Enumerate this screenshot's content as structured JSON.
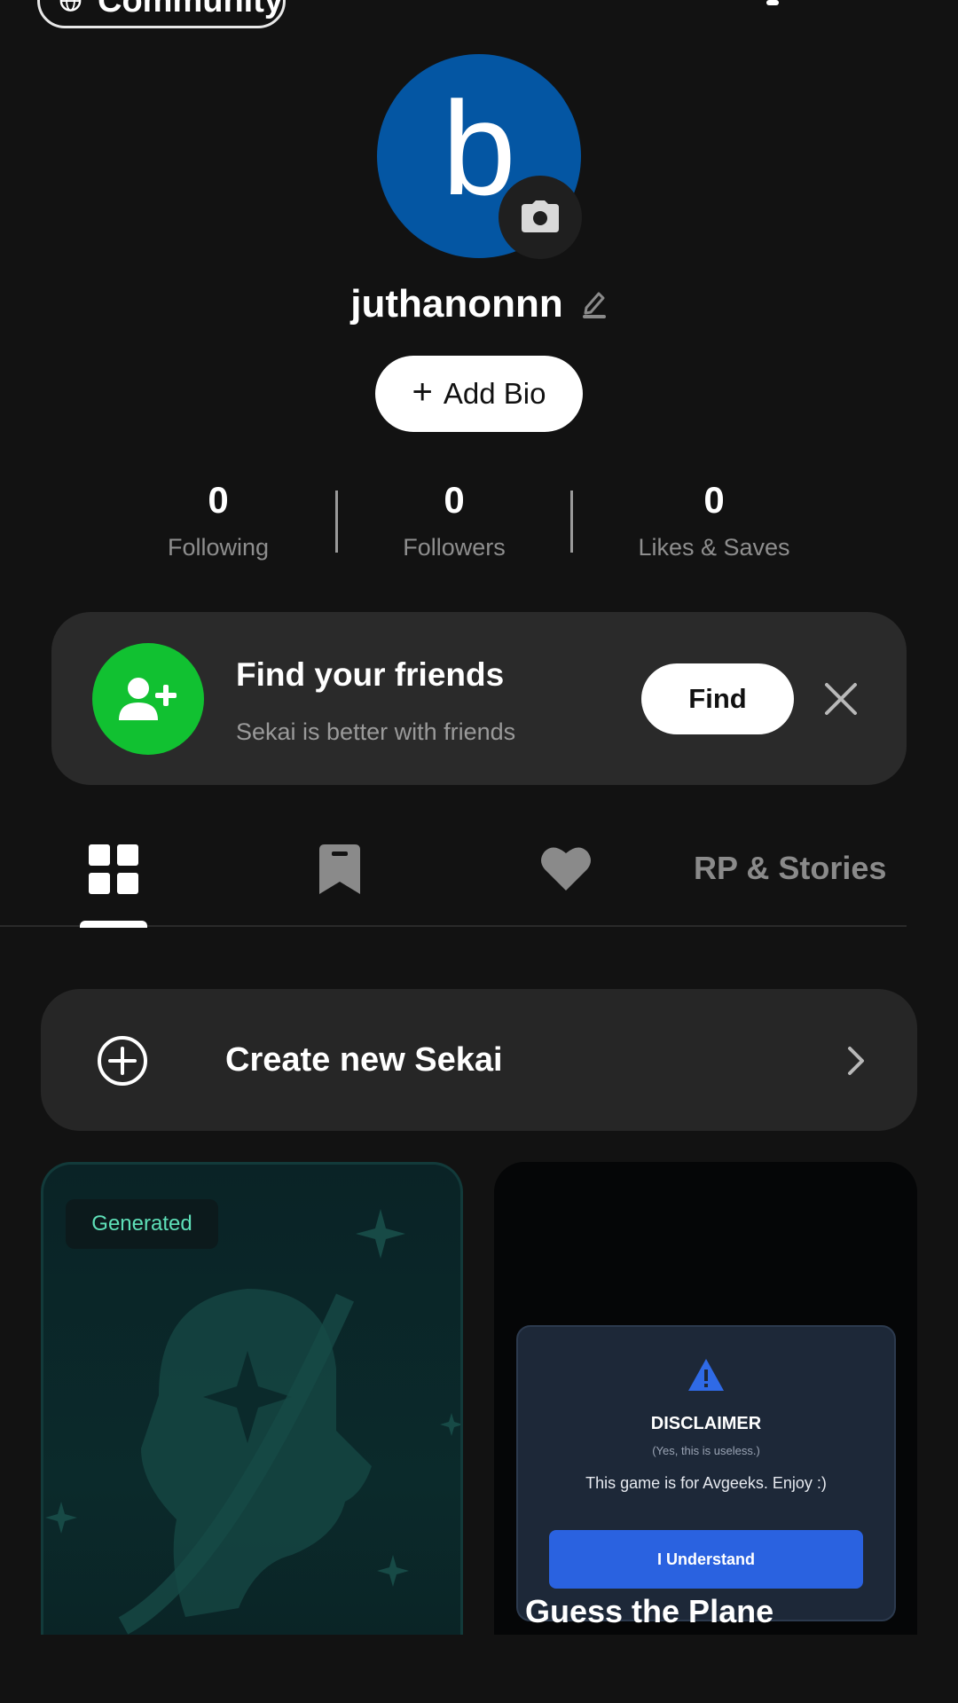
{
  "topbar": {
    "community_label": "Community"
  },
  "profile": {
    "avatar_letter": "b",
    "avatar_color": "#0456a3",
    "username": "juthanonnn",
    "add_bio_label": "Add Bio"
  },
  "stats": [
    {
      "value": "0",
      "label": "Following"
    },
    {
      "value": "0",
      "label": "Followers"
    },
    {
      "value": "0",
      "label": "Likes & Saves"
    }
  ],
  "friends_card": {
    "title": "Find your friends",
    "subtitle": "Sekai is better with friends",
    "button_label": "Find",
    "icon_color": "#11c131"
  },
  "tabs": {
    "grid_icon": "grid-icon",
    "bookmark_icon": "bookmark-icon",
    "heart_icon": "heart-icon",
    "stories_label": "RP & Stories",
    "active": "grid"
  },
  "create": {
    "label": "Create new Sekai"
  },
  "cards": [
    {
      "badge": "Generated"
    },
    {
      "disclaimer_title": "DISCLAIMER",
      "disclaimer_sub": "(Yes, this is useless.)",
      "disclaimer_text": "This game is for Avgeeks. Enjoy :)",
      "disclaimer_button": "I Understand",
      "title": "Guess the Plane"
    }
  ]
}
